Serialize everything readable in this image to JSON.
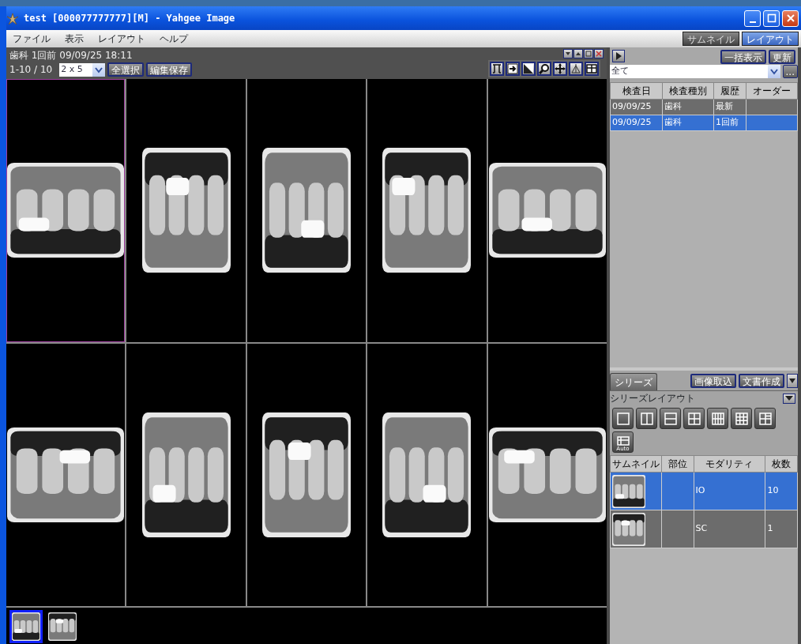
{
  "window": {
    "title": "test [000077777777][M] - Yahgee Image"
  },
  "menu": [
    "ファイル",
    "表示",
    "レイアウト",
    "ヘルプ"
  ],
  "view_tabs": [
    {
      "label": "サムネイル",
      "selected": false
    },
    {
      "label": "レイアウト",
      "selected": true
    }
  ],
  "viewer": {
    "study_info": "歯科 1回前 09/09/25 18:11",
    "count": "1-10 / 10",
    "layout_value": "2 x 5",
    "buttons": [
      "全選択",
      "編集保存"
    ],
    "cells": [
      {
        "kind": "landscape",
        "selected": true
      },
      {
        "kind": "portrait",
        "selected": false
      },
      {
        "kind": "portrait",
        "selected": false
      },
      {
        "kind": "portrait",
        "selected": false
      },
      {
        "kind": "landscape",
        "selected": false
      },
      {
        "kind": "landscape",
        "selected": false
      },
      {
        "kind": "portrait",
        "selected": false
      },
      {
        "kind": "portrait",
        "selected": false
      },
      {
        "kind": "portrait",
        "selected": false
      },
      {
        "kind": "landscape",
        "selected": false
      }
    ],
    "strip": [
      {
        "kind": "picture",
        "selected": true
      },
      {
        "kind": "picture",
        "selected": false
      }
    ]
  },
  "studies": {
    "buttons": [
      "一括表示",
      "更新"
    ],
    "filter_value": "全て",
    "more_label": "...",
    "columns": [
      "検査日",
      "検査種別",
      "履歴",
      "オーダー"
    ],
    "rows": [
      {
        "cells": [
          "09/09/25",
          "歯科",
          "最新",
          ""
        ],
        "selected": false
      },
      {
        "cells": [
          "09/09/25",
          "歯科",
          "1回前",
          ""
        ],
        "selected": true
      }
    ]
  },
  "series": {
    "tab": "シリーズ",
    "buttons": [
      "画像取込",
      "文書作成"
    ],
    "layout_label": "シリーズレイアウト",
    "auto_label": "Auto",
    "columns": [
      "サムネイル",
      "部位",
      "モダリティ",
      "枚数"
    ],
    "rows": [
      {
        "cells": [
          "",
          "",
          "IO",
          "10"
        ],
        "selected": true
      },
      {
        "cells": [
          "",
          "",
          "SC",
          "1"
        ],
        "selected": false
      }
    ]
  }
}
